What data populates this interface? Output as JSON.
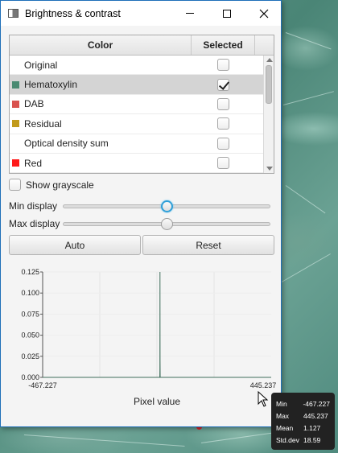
{
  "window": {
    "title": "Brightness & contrast"
  },
  "table": {
    "headers": {
      "color": "Color",
      "selected": "Selected"
    },
    "rows": [
      {
        "label": "Original",
        "color": null,
        "selected": false
      },
      {
        "label": "Hematoxylin",
        "color": "#4a8a72",
        "selected": true,
        "highlighted": true
      },
      {
        "label": "DAB",
        "color": "#d9534f",
        "selected": false
      },
      {
        "label": "Residual",
        "color": "#c19a1b",
        "selected": false
      },
      {
        "label": "Optical density sum",
        "color": null,
        "selected": false
      },
      {
        "label": "Red",
        "color": "#ff1a1a",
        "selected": false
      }
    ]
  },
  "grayscale": {
    "label": "Show grayscale",
    "checked": false
  },
  "min_display": {
    "label": "Min display",
    "value_fraction": 0.5
  },
  "max_display": {
    "label": "Max display",
    "value_fraction": 0.5
  },
  "buttons": {
    "auto": "Auto",
    "reset": "Reset"
  },
  "chart_data": {
    "type": "area",
    "xlabel": "Pixel value",
    "ylabel": "",
    "xlim": [
      -467.227,
      445.237
    ],
    "ylim": [
      0,
      0.125
    ],
    "x_tick_labels": [
      "-467.227",
      "445.237"
    ],
    "y_ticks": [
      0.0,
      0.025,
      0.05,
      0.075,
      0.1,
      0.125
    ],
    "y_tick_labels": [
      "0.000",
      "0.025",
      "0.050",
      "0.075",
      "0.100",
      "0.125"
    ],
    "series": [
      {
        "color": "#3f6e5c",
        "x": [
          -467.227,
          0.5,
          0.9,
          1.1,
          1.2,
          1.3,
          1.5,
          2.0,
          445.237
        ],
        "y": [
          0,
          0,
          0.01,
          0.09,
          0.125,
          0.08,
          0.02,
          0,
          0
        ]
      }
    ],
    "grid": true
  },
  "stats": {
    "min_label": "Min",
    "min": "-467.227",
    "max_label": "Max",
    "max": "445.237",
    "mean_label": "Mean",
    "mean": "1.127",
    "std_label": "Std.dev",
    "std": "18.59"
  },
  "colors": {
    "window_border": "#1e6fb8",
    "focus": "#2e9fd8"
  }
}
